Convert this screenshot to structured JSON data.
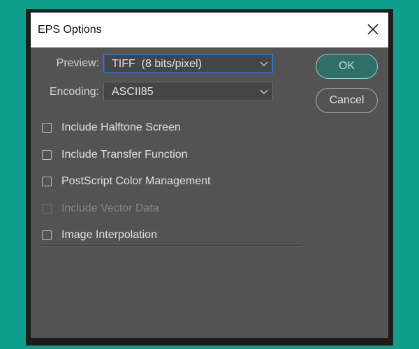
{
  "dialog": {
    "title": "EPS Options",
    "close_icon": "close-icon"
  },
  "preview": {
    "label": "Preview:",
    "value": "TIFF  (8 bits/pixel)"
  },
  "encoding": {
    "label": "Encoding:",
    "value": "ASCII85"
  },
  "options": [
    {
      "label": "Include Halftone Screen",
      "checked": false,
      "enabled": true
    },
    {
      "label": "Include Transfer Function",
      "checked": false,
      "enabled": true
    },
    {
      "label": "PostScript Color Management",
      "checked": false,
      "enabled": true
    },
    {
      "label": "Include Vector Data",
      "checked": false,
      "enabled": false
    },
    {
      "label": "Image Interpolation",
      "checked": false,
      "enabled": true
    }
  ],
  "buttons": {
    "ok": "OK",
    "cancel": "Cancel"
  },
  "colors": {
    "background": "#0d9e8c",
    "panel": "#535353",
    "accent_focus": "#3a7bd5",
    "ok_button": "#2f6f6a"
  }
}
